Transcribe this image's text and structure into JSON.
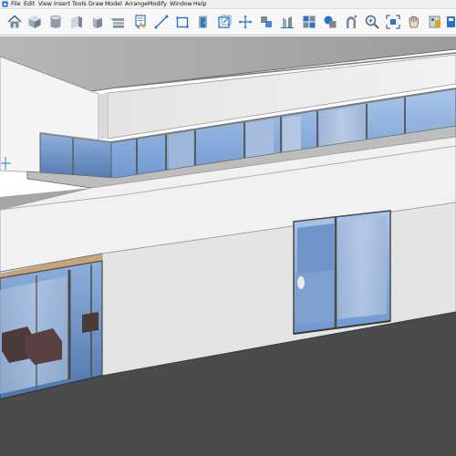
{
  "menu": {
    "items": [
      "File",
      "Edit",
      "View",
      "Insert",
      "Tools",
      "Draw",
      "Model",
      "Arrange",
      "Modify",
      "Window",
      "Help"
    ]
  },
  "toolbar": {
    "tools": [
      "home-icon",
      "cube-icon",
      "cylinder-icon",
      "wall-icon",
      "box-icon",
      "slab-icon",
      "pen-icon",
      "line-icon",
      "rectangle-icon",
      "door-icon",
      "stretch-icon",
      "move-icon",
      "align-icon",
      "sweep-icon",
      "group-icon",
      "union-icon",
      "arch-icon",
      "zoom-icon",
      "zoom-extents-icon",
      "pan-icon",
      "material-icon",
      "paint-icon",
      "measure-icon"
    ]
  },
  "colors": {
    "toolbar_bg": "#f7f7f7",
    "icon_blue": "#2a73c8",
    "icon_gray": "#7b8896",
    "glass": "#8fb4e3",
    "wall": "#eeeeee",
    "ground": "#4b4b4b",
    "ceiling": "#a8a8a8"
  }
}
